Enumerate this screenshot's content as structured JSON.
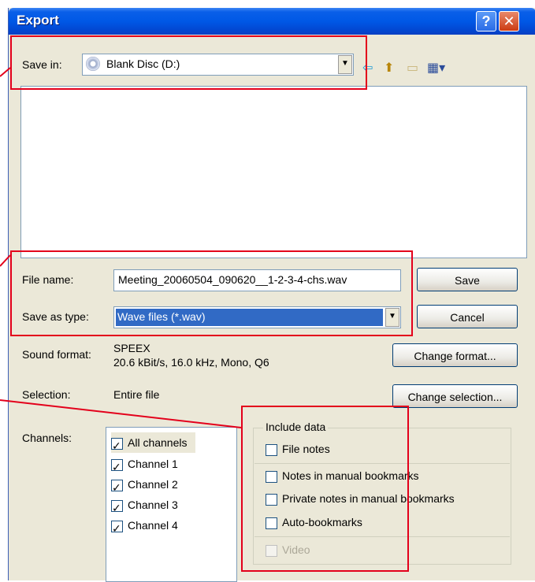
{
  "window": {
    "title": "Export",
    "help_label": "?",
    "close_label": "✕"
  },
  "save_in": {
    "label": "Save in:",
    "value": "Blank Disc (D:)"
  },
  "toolbar_icons": [
    "back-icon",
    "up-folder-icon",
    "new-folder-icon",
    "view-menu-icon"
  ],
  "file_name": {
    "label": "File name:",
    "value": "Meeting_20060504_090620__1-2-3-4-chs.wav"
  },
  "save_as_type": {
    "label": "Save as type:",
    "value": "Wave files (*.wav)"
  },
  "buttons": {
    "save": "Save",
    "cancel": "Cancel",
    "change_format": "Change format...",
    "change_selection": "Change selection..."
  },
  "sound_format": {
    "label": "Sound format:",
    "codec": "SPEEX",
    "details": "20.6 kBit/s, 16.0 kHz, Mono, Q6"
  },
  "selection": {
    "label": "Selection:",
    "value": "Entire file"
  },
  "channels": {
    "label": "Channels:",
    "items": [
      {
        "label": "All channels",
        "checked": true
      },
      {
        "label": "Channel 1",
        "checked": true
      },
      {
        "label": "Channel 2",
        "checked": true
      },
      {
        "label": "Channel 3",
        "checked": true
      },
      {
        "label": "Channel 4",
        "checked": true
      }
    ]
  },
  "include_data": {
    "title": "Include data",
    "items": [
      {
        "label": "File notes",
        "checked": false,
        "enabled": true
      },
      {
        "label": "Notes in manual bookmarks",
        "checked": false,
        "enabled": true
      },
      {
        "label": "Private notes in manual bookmarks",
        "checked": false,
        "enabled": true
      },
      {
        "label": "Auto-bookmarks",
        "checked": false,
        "enabled": true
      },
      {
        "label": "Video",
        "checked": false,
        "enabled": false
      }
    ]
  },
  "colors": {
    "title_bar": "#0058e6",
    "highlight": "#e3001b",
    "selection": "#316ac5"
  }
}
